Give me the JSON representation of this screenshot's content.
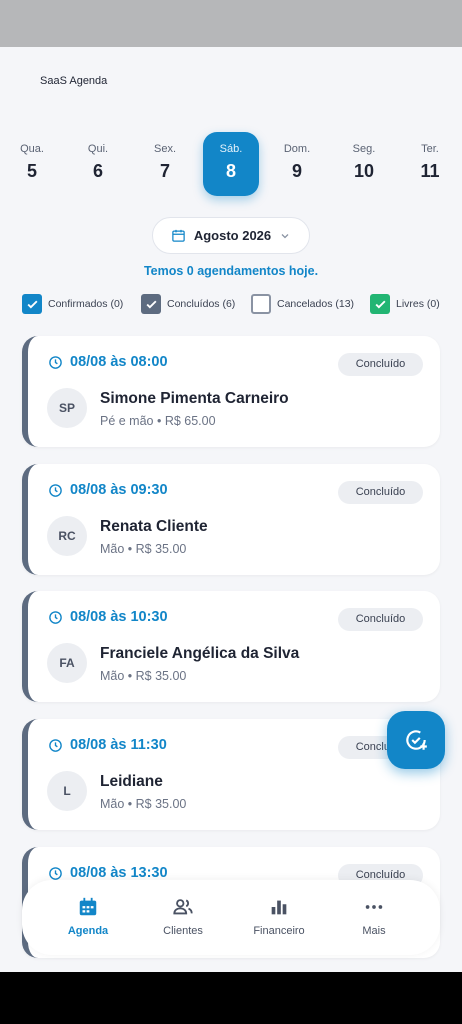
{
  "app": {
    "title": "SaaS Agenda"
  },
  "days": [
    {
      "name": "Qua.",
      "num": "5"
    },
    {
      "name": "Qui.",
      "num": "6"
    },
    {
      "name": "Sex.",
      "num": "7"
    },
    {
      "name": "Sáb.",
      "num": "8"
    },
    {
      "name": "Dom.",
      "num": "9"
    },
    {
      "name": "Seg.",
      "num": "10"
    },
    {
      "name": "Ter.",
      "num": "11"
    }
  ],
  "selected_day_index": 3,
  "month_selector": {
    "label": "Agosto 2026",
    "icon": "calendar-icon"
  },
  "summary": "Temos 0 agendamentos hoje.",
  "filters": [
    {
      "label": "Confirmados (0)",
      "checked": true,
      "color": "#1286c8"
    },
    {
      "label": "Concluídos (6)",
      "checked": true,
      "color": "#5d6b80"
    },
    {
      "label": "Cancelados (13)",
      "checked": false,
      "color": "#8a93a3"
    },
    {
      "label": "Livres (0)",
      "checked": true,
      "color": "#22b573"
    }
  ],
  "appointments": [
    {
      "time": "08/08 às 08:00",
      "status": "Concluído",
      "initials": "SP",
      "name": "Simone Pimenta Carneiro",
      "service": "Pé e mão • R$ 65.00"
    },
    {
      "time": "08/08 às 09:30",
      "status": "Concluído",
      "initials": "RC",
      "name": "Renata Cliente",
      "service": "Mão  • R$ 35.00"
    },
    {
      "time": "08/08 às 10:30",
      "status": "Concluído",
      "initials": "FA",
      "name": "Franciele Angélica da Silva",
      "service": "Mão  • R$ 35.00"
    },
    {
      "time": "08/08 às 11:30",
      "status": "Concluído",
      "initials": "L",
      "name": "Leidiane",
      "service": "Mão  • R$ 35.00"
    },
    {
      "time": "08/08 às 13:30",
      "status": "Concluído",
      "initials": "",
      "name": "",
      "service": ""
    }
  ],
  "nav": [
    {
      "label": "Agenda",
      "icon": "calendar-icon",
      "active": true
    },
    {
      "label": "Clientes",
      "icon": "users-icon",
      "active": false
    },
    {
      "label": "Financeiro",
      "icon": "bar-chart-icon",
      "active": false
    },
    {
      "label": "Mais",
      "icon": "more-dots-icon",
      "active": false
    }
  ],
  "colors": {
    "accent": "#1286c8",
    "card_border": "#5d6b80",
    "background": "#f5f6f9"
  }
}
